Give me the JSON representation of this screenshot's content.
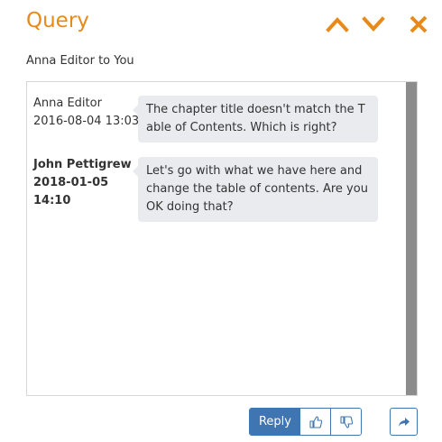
{
  "header": {
    "title": "Query",
    "colors": {
      "accent": "#e8891b",
      "primary": "#3f75b0"
    },
    "icons": {
      "up": "chevron-up-icon",
      "down": "chevron-down-icon",
      "close": "close-icon"
    }
  },
  "subtitle": "Anna Editor to You",
  "messages": [
    {
      "author": "Anna Editor",
      "timestamp": "2016-08-04 13:03",
      "text": "The chapter title doesn't match the Table of Contents. Which is right?"
    },
    {
      "author": "John Pettigrew",
      "timestamp": "2018-01-05 14:10",
      "text": "Let's go with what we have here and change the table of contents. Are you OK doing that?"
    }
  ],
  "footer": {
    "reply_label": "Reply",
    "icons": {
      "upvote": "thumbs-up-icon",
      "downvote": "thumbs-down-icon",
      "forward": "share-forward-icon"
    }
  }
}
